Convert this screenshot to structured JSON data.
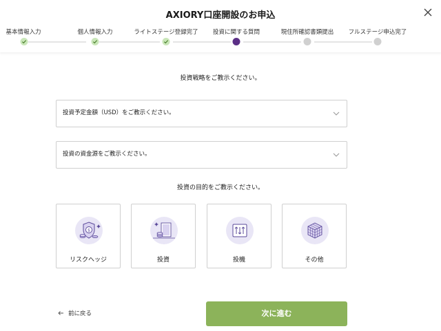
{
  "header": {
    "title": "AXIORY口座開設のお申込",
    "close_icon": "close-icon"
  },
  "steps": [
    {
      "label": "基本情報入力",
      "status": "done"
    },
    {
      "label": "個人情報入力",
      "status": "done"
    },
    {
      "label": "ライトステージ登録完了",
      "status": "done"
    },
    {
      "label": "投資に関する質問",
      "status": "current"
    },
    {
      "label": "現住所確認書類提出",
      "status": "todo"
    },
    {
      "label": "フルステージ申込完了",
      "status": "todo"
    }
  ],
  "form": {
    "strategy_prompt": "投資戦略をご教示ください。",
    "amount_select": "投資予定金額（USD）をご教示ください。",
    "source_select": "投資の資金源をご教示ください。",
    "purpose_prompt": "投資の目的をご教示ください。",
    "purposes": [
      {
        "label": "リスクヘッジ",
        "icon": "shield-coin-icon"
      },
      {
        "label": "投資",
        "icon": "coins-door-icon"
      },
      {
        "label": "投機",
        "icon": "chart-arrows-icon"
      },
      {
        "label": "その他",
        "icon": "cube-grid-icon"
      }
    ]
  },
  "footer": {
    "back_label": "前に戻る",
    "next_label": "次に進む"
  },
  "colors": {
    "accent_purple": "#5b2f86",
    "done_green": "#c9e6b8",
    "next_button": "#8cb35a",
    "icon_bg": "#e9e6f6"
  }
}
